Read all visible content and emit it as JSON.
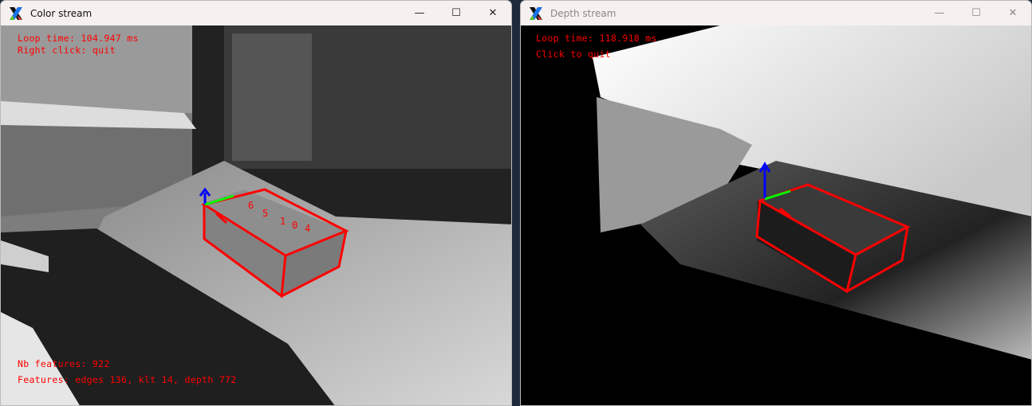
{
  "color_window": {
    "title": "Color stream",
    "overlay": {
      "loop_time": "Loop time: 104.947 ms",
      "hint": "Right click: quit",
      "nb_features": "Nb features: 922",
      "features": "Features: edges 136, klt 14, depth 772"
    },
    "point_labels": [
      "6",
      "5",
      "1",
      "0",
      "4"
    ]
  },
  "depth_window": {
    "title": "Depth stream",
    "overlay": {
      "loop_time": "Loop time: 118.918 ms",
      "hint": "Click to quit"
    }
  },
  "window_controls": {
    "minimize": "—",
    "maximize": "☐",
    "close": "✕"
  },
  "colors": {
    "overlay_text": "#ff0000",
    "box_edges": "#ff0000",
    "axis_x": "#ff0000",
    "axis_y": "#00ff00",
    "axis_z": "#0000ff"
  }
}
